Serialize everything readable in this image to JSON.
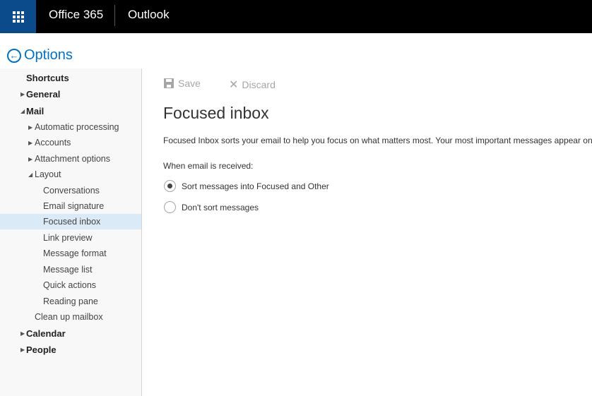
{
  "topbar": {
    "brand": "Office 365",
    "app_name": "Outlook",
    "waffle_icon": "app-launcher-icon",
    "background": "#000000",
    "launcher_color": "#0b4a8b"
  },
  "options": {
    "title": "Options",
    "back_icon": "back-arrow-circle-icon",
    "accent": "#0072c6"
  },
  "sidebar": {
    "items": [
      {
        "label": "Shortcuts",
        "level": 0,
        "toggle": "none"
      },
      {
        "label": "General",
        "level": 0,
        "toggle": "collapsed"
      },
      {
        "label": "Mail",
        "level": 0,
        "toggle": "expanded"
      },
      {
        "label": "Automatic processing",
        "level": 1,
        "toggle": "collapsed"
      },
      {
        "label": "Accounts",
        "level": 1,
        "toggle": "collapsed"
      },
      {
        "label": "Attachment options",
        "level": 1,
        "toggle": "collapsed"
      },
      {
        "label": "Layout",
        "level": 1,
        "toggle": "expanded"
      },
      {
        "label": "Conversations",
        "level": 2,
        "toggle": "none"
      },
      {
        "label": "Email signature",
        "level": 2,
        "toggle": "none"
      },
      {
        "label": "Focused inbox",
        "level": 2,
        "toggle": "none",
        "selected": true
      },
      {
        "label": "Link preview",
        "level": 2,
        "toggle": "none"
      },
      {
        "label": "Message format",
        "level": 2,
        "toggle": "none"
      },
      {
        "label": "Message list",
        "level": 2,
        "toggle": "none"
      },
      {
        "label": "Quick actions",
        "level": 2,
        "toggle": "none"
      },
      {
        "label": "Reading pane",
        "level": 2,
        "toggle": "none"
      },
      {
        "label": "Clean up mailbox",
        "level": 1,
        "toggle": "none"
      },
      {
        "label": "Calendar",
        "level": 0,
        "toggle": "collapsed"
      },
      {
        "label": "People",
        "level": 0,
        "toggle": "collapsed"
      }
    ],
    "selected_color": "#dbeaf7"
  },
  "toolbar": {
    "save_label": "Save",
    "discard_label": "Discard"
  },
  "main": {
    "title": "Focused inbox",
    "description": "Focused Inbox sorts your email to help you focus on what matters most. Your most important messages appear on",
    "group_label": "When email is received:",
    "radio_options": [
      {
        "label": "Sort messages into Focused and Other",
        "checked": true
      },
      {
        "label": "Don't sort messages",
        "checked": false
      }
    ]
  }
}
